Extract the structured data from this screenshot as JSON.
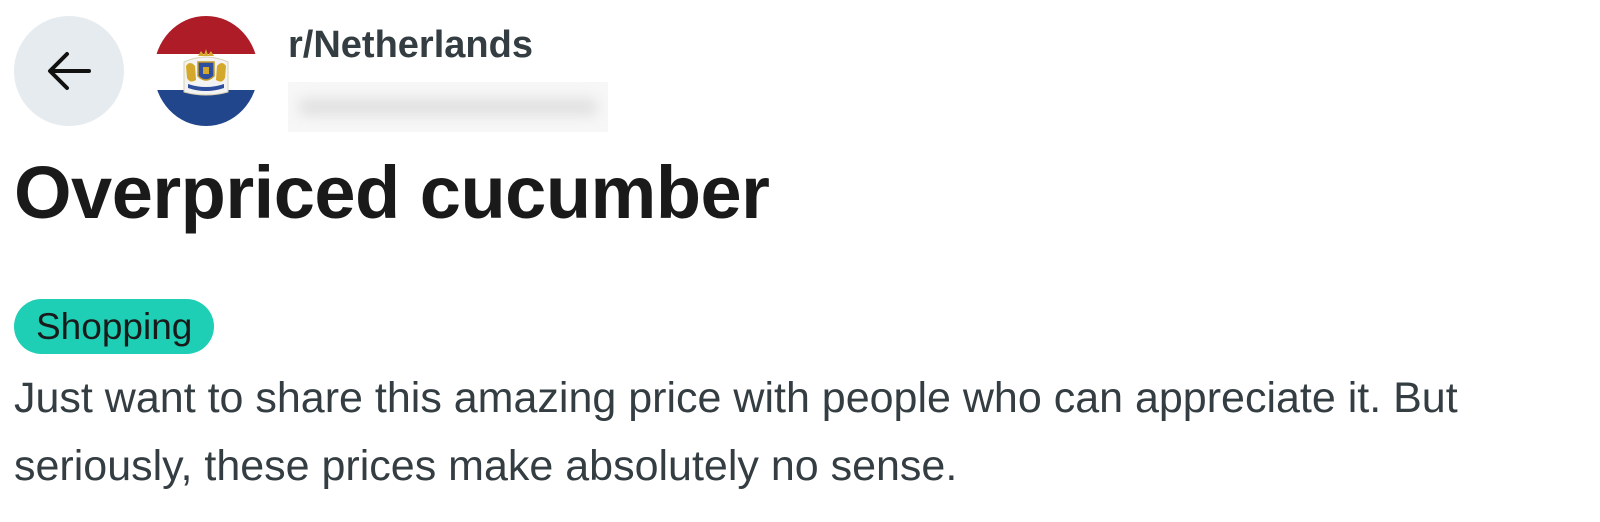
{
  "header": {
    "back_icon": "arrow-left-icon",
    "community_name": "r/Netherlands",
    "community_avatar_icon": "netherlands-flag-coat-of-arms-icon",
    "colors": {
      "flag_red": "#ae1c28",
      "flag_white": "#ffffff",
      "flag_blue": "#21468b",
      "back_button_bg": "#e6ebef"
    }
  },
  "post": {
    "title": "Overpriced cucumber",
    "flair": {
      "label": "Shopping",
      "color": "#1ecfb5"
    },
    "body": "Just want to share this amazing price with people who can appreciate it. But seriously, these prices make absolutely no sense."
  }
}
